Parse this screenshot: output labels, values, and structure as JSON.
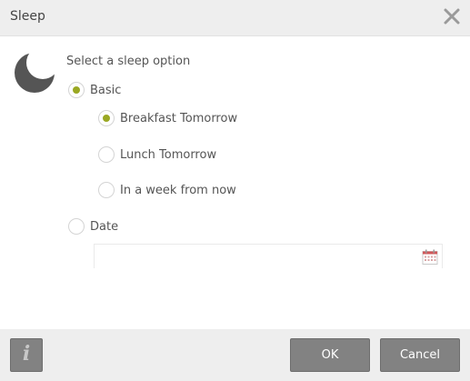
{
  "dialog": {
    "title": "Sleep",
    "prompt": "Select a sleep option"
  },
  "options": {
    "basic": {
      "label": "Basic",
      "checked": true
    },
    "breakfast": {
      "label": "Breakfast Tomorrow",
      "checked": true
    },
    "lunch": {
      "label": "Lunch Tomorrow",
      "checked": false
    },
    "week": {
      "label": "In a week from now",
      "checked": false
    },
    "date": {
      "label": "Date",
      "checked": false
    }
  },
  "date_input": {
    "value": ""
  },
  "footer": {
    "ok_label": "OK",
    "cancel_label": "Cancel",
    "info_label": "i"
  },
  "colors": {
    "accent_radio": "#9aa823",
    "button_bg": "#828282",
    "bar_bg": "#eeeeee"
  },
  "icons": {
    "close": "close-icon",
    "moon": "moon-icon",
    "calendar": "calendar-icon",
    "info": "info-icon"
  }
}
